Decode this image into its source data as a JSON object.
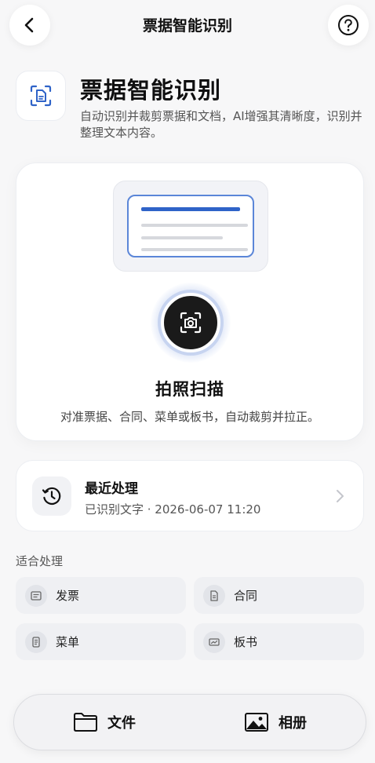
{
  "topbar": {
    "title": "票据智能识别"
  },
  "hero": {
    "title": "票据智能识别",
    "description": "自动识别并裁剪票据和文档，AI增强其清晰度，识别并整理文本内容。"
  },
  "scan_card": {
    "title": "拍照扫描",
    "description": "对准票据、合同、菜单或板书，自动裁剪并拉正。"
  },
  "recent": {
    "title": "最近处理",
    "subtitle": "已识别文字 · 2026-06-07 11:20"
  },
  "suitable": {
    "label": "适合处理",
    "items": [
      {
        "label": "发票",
        "icon": "invoice-icon"
      },
      {
        "label": "合同",
        "icon": "contract-icon"
      },
      {
        "label": "菜单",
        "icon": "menu-icon"
      },
      {
        "label": "板书",
        "icon": "blackboard-icon"
      }
    ]
  },
  "bottom": {
    "file_label": "文件",
    "album_label": "相册"
  },
  "colors": {
    "accent": "#2f63c8",
    "shutter": "#1a1a1a",
    "background": "#f7f7f8"
  }
}
